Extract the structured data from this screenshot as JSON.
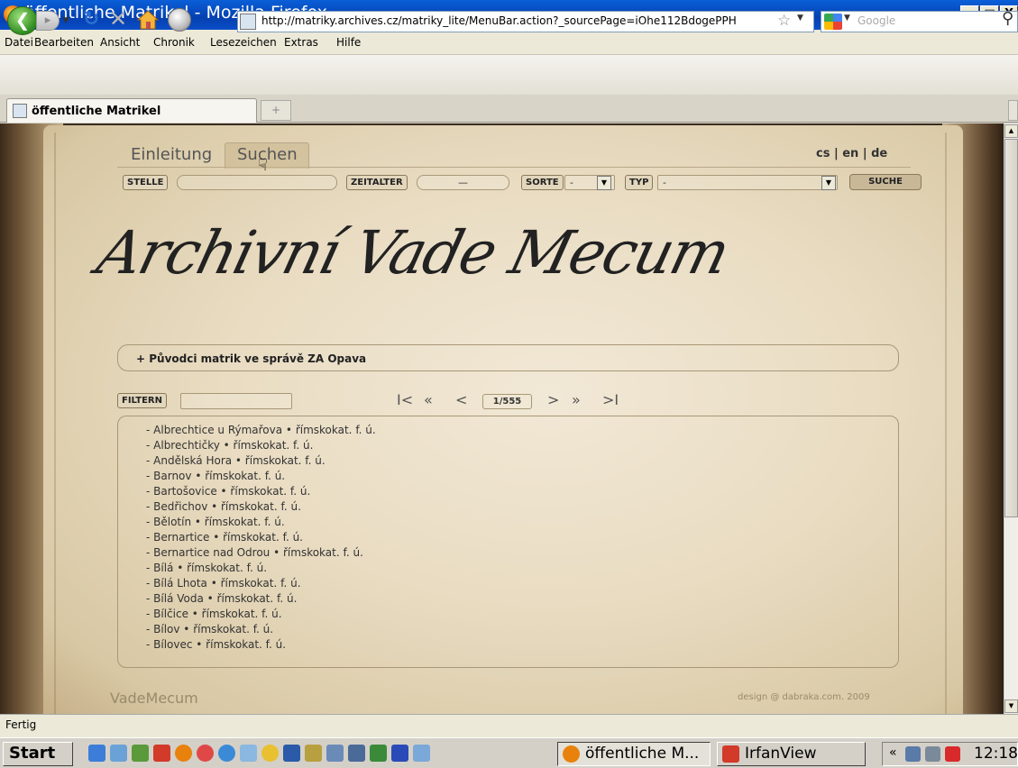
{
  "window": {
    "title": "öffentliche Matrikel - Mozilla Firefox",
    "minimize": "_",
    "maximize": "□",
    "close": "X"
  },
  "menu": [
    "Datei",
    "Bearbeiten",
    "Ansicht",
    "Chronik",
    "Lesezeichen",
    "Extras",
    "Hilfe"
  ],
  "nav": {
    "url": "http://matriky.archives.cz/matriky_lite/MenuBar.action?_sourcePage=iOhe112BdogePPH",
    "search_placeholder": "Google"
  },
  "tab": {
    "label": "öffentliche Matrikel",
    "new_tab": "+"
  },
  "site": {
    "nav": [
      "Einleitung",
      "Suchen"
    ],
    "lang": "cs | en | de",
    "filters": {
      "stelle": "STELLE",
      "zeitalter": "ZEITALTER",
      "zeitalter_value": "—",
      "sorte": "SORTE",
      "sorte_value": "-",
      "typ": "TYP",
      "typ_value": "-",
      "suche": "SUCHE"
    },
    "logo": "Archivní Vade Mecum",
    "panel_title": "+ Původci matrik ve správě ZA Opava",
    "filter_label": "FILTERN",
    "pager": {
      "first": "I<",
      "prev_page": "«",
      "prev": "<",
      "page": "1/555",
      "next": ">",
      "next_page": "»",
      "last": ">I"
    },
    "list": [
      "- Albrechtice u Rýmařova • římskokat. f. ú.",
      "- Albrechtičky • římskokat. f. ú.",
      "- Andělská Hora • římskokat. f. ú.",
      "- Barnov • římskokat. f. ú.",
      "- Bartošovice • římskokat. f. ú.",
      "- Bedřichov • římskokat. f. ú.",
      "- Bělotín • římskokat. f. ú.",
      "- Bernartice • římskokat. f. ú.",
      "- Bernartice nad Odrou • římskokat. f. ú.",
      "- Bílá • římskokat. f. ú.",
      "- Bílá Lhota • římskokat. f. ú.",
      "- Bílá Voda • římskokat. f. ú.",
      "- Bílčice • římskokat. f. ú.",
      "- Bílov • římskokat. f. ú.",
      "- Bílovec • římskokat. f. ú."
    ],
    "footer_brand": "VadeMecum",
    "footer_credit": "design @ dabraka.com. 2009"
  },
  "status": "Fertig",
  "taskbar": {
    "start": "Start",
    "tasks": [
      "öffentliche M...",
      "IrfanView"
    ],
    "tray_expand": "«",
    "clock": "12:18"
  }
}
